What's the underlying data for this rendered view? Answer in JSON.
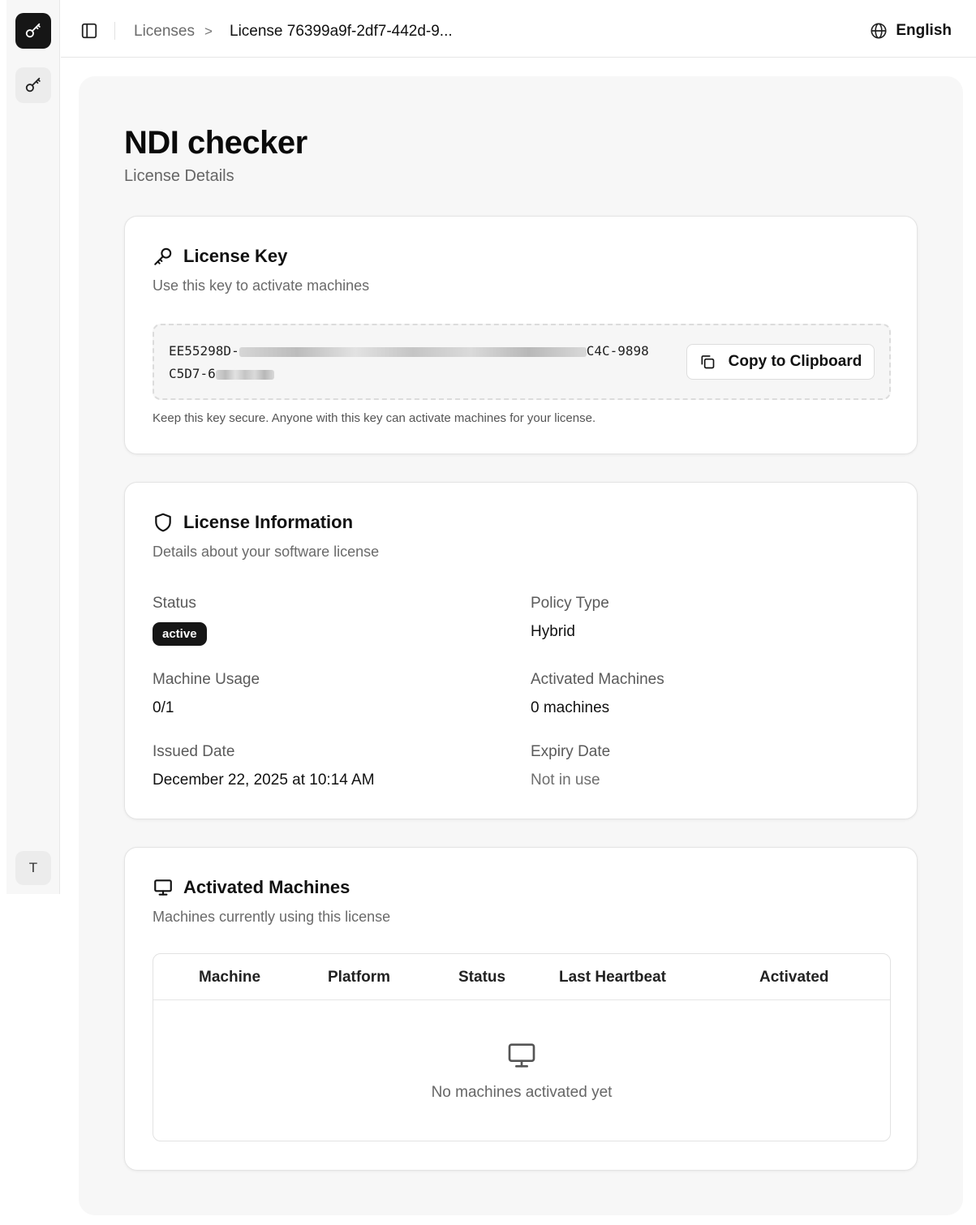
{
  "sidebar": {
    "logo_icon": "key-icon",
    "nav_icon": "key-icon",
    "user_initial": "T"
  },
  "header": {
    "toggle_icon": "sidebar-toggle-icon",
    "breadcrumb_parent": "Licenses",
    "breadcrumb_separator": ">",
    "breadcrumb_current": "License 76399a9f-2df7-442d-9...",
    "language": "English",
    "language_icon": "globe-icon"
  },
  "page": {
    "title": "NDI checker",
    "subtitle": "License Details"
  },
  "license_key": {
    "title": "License Key",
    "icon": "key-icon",
    "description": "Use this key to activate machines",
    "key_line1_start": "EE55298D-",
    "key_line1_end": "C4C-9898",
    "key_line2_start": "C5D7-6",
    "copy_button": "Copy to Clipboard",
    "copy_icon": "copy-icon",
    "note": "Keep this key secure. Anyone with this key can activate machines for your license."
  },
  "license_info": {
    "title": "License Information",
    "icon": "shield-icon",
    "description": "Details about your software license",
    "status_label": "Status",
    "status_value": "active",
    "policy_label": "Policy Type",
    "policy_value": "Hybrid",
    "usage_label": "Machine Usage",
    "usage_value": "0/1",
    "activated_label": "Activated Machines",
    "activated_value": "0 machines",
    "issued_label": "Issued Date",
    "issued_value": "December 22, 2025 at 10:14 AM",
    "expiry_label": "Expiry Date",
    "expiry_value": "Not in use"
  },
  "machines": {
    "title": "Activated Machines",
    "icon": "monitor-icon",
    "description": "Machines currently using this license",
    "columns": [
      "Machine",
      "Platform",
      "Status",
      "Last Heartbeat",
      "Activated"
    ],
    "empty_text": "No machines activated yet",
    "empty_icon": "monitor-icon"
  },
  "colors": {
    "accent_dark": "#161616",
    "panel_bg": "#f7f7f7",
    "border": "#e4e4e4"
  }
}
